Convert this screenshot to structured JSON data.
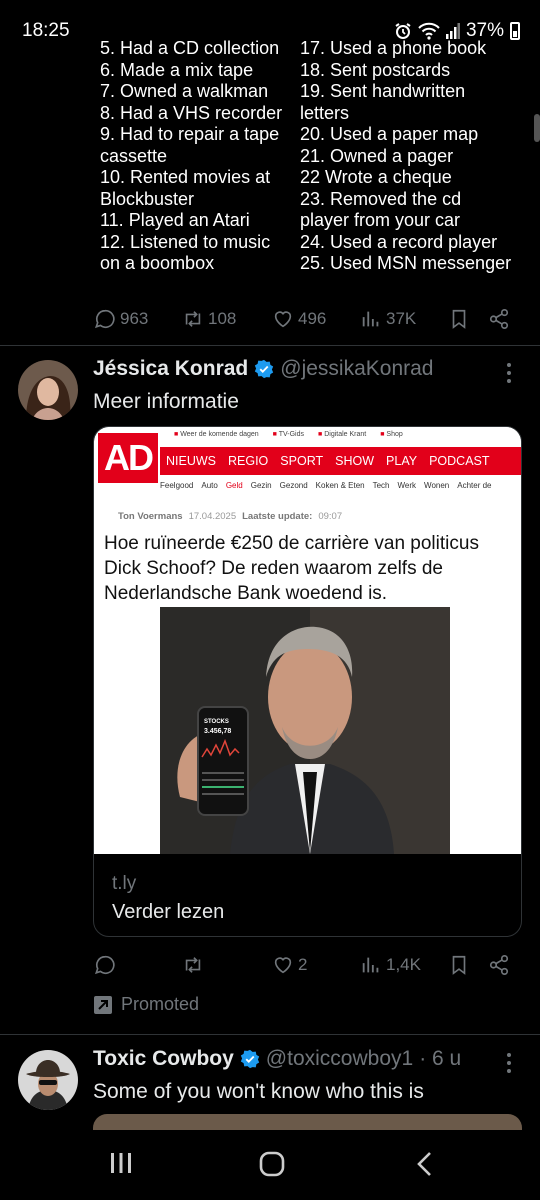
{
  "status_bar": {
    "time": "18:25",
    "battery": "37%"
  },
  "tweet1": {
    "list_col1": [
      "5. Had a CD collection",
      "6. Made a mix tape",
      "7. Owned a walkman",
      "8. Had a VHS recorder",
      "9. Had to repair a tape\ncassette",
      "10. Rented movies at\nBlockbuster",
      "11. Played an Atari",
      "12. Listened to music\non a boombox"
    ],
    "list_col2": [
      "17. Used a phone book",
      "18. Sent postcards",
      "19. Sent handwritten\nletters",
      "20. Used a paper map",
      "21. Owned a pager",
      "22 Wrote a cheque",
      "23. Removed the cd\nplayer from your car",
      "24. Used a record player",
      "25. Used MSN messenger"
    ],
    "actions": {
      "replies": "963",
      "reposts": "108",
      "likes": "496",
      "views": "37K"
    }
  },
  "tweet2": {
    "name": "Jéssica Konrad",
    "handle": "@jessikaKonrad",
    "text": "Meer informatie",
    "card": {
      "site_logo": "AD",
      "mini_links": [
        "Weer de komende dagen",
        "TV-Gids",
        "Digitale Krant",
        "Shop"
      ],
      "nav": [
        "NIEUWS",
        "REGIO",
        "SPORT",
        "SHOW",
        "PLAY",
        "PODCAST"
      ],
      "subnav": [
        "Feelgood",
        "Auto",
        "Geld",
        "Gezin",
        "Gezond",
        "Koken & Eten",
        "Tech",
        "Werk",
        "Wonen",
        "Achter de"
      ],
      "author": "Ton Voermans",
      "date": "17.04.2025",
      "update_label": "Laatste update:",
      "update_time": "09:07",
      "headline": "Hoe ruïneerde €250 de carrière van politicus Dick Schoof? De reden waarom zelfs de Nederlandsche Bank woedend is.",
      "phone_label": "STOCKS",
      "phone_value": "3.456,78",
      "domain": "t.ly",
      "cta": "Verder lezen"
    },
    "actions": {
      "replies": "",
      "reposts": "",
      "likes": "2",
      "views": "1,4K"
    },
    "promoted": "Promoted"
  },
  "tweet3": {
    "name": "Toxic Cowboy",
    "handle": "@toxiccowboy1",
    "time": "· 6 u",
    "text": "Some of you won't know who this is"
  },
  "colors": {
    "accent_red": "#e2001a",
    "verified_blue": "#1d9bf0",
    "muted": "#71767b"
  }
}
